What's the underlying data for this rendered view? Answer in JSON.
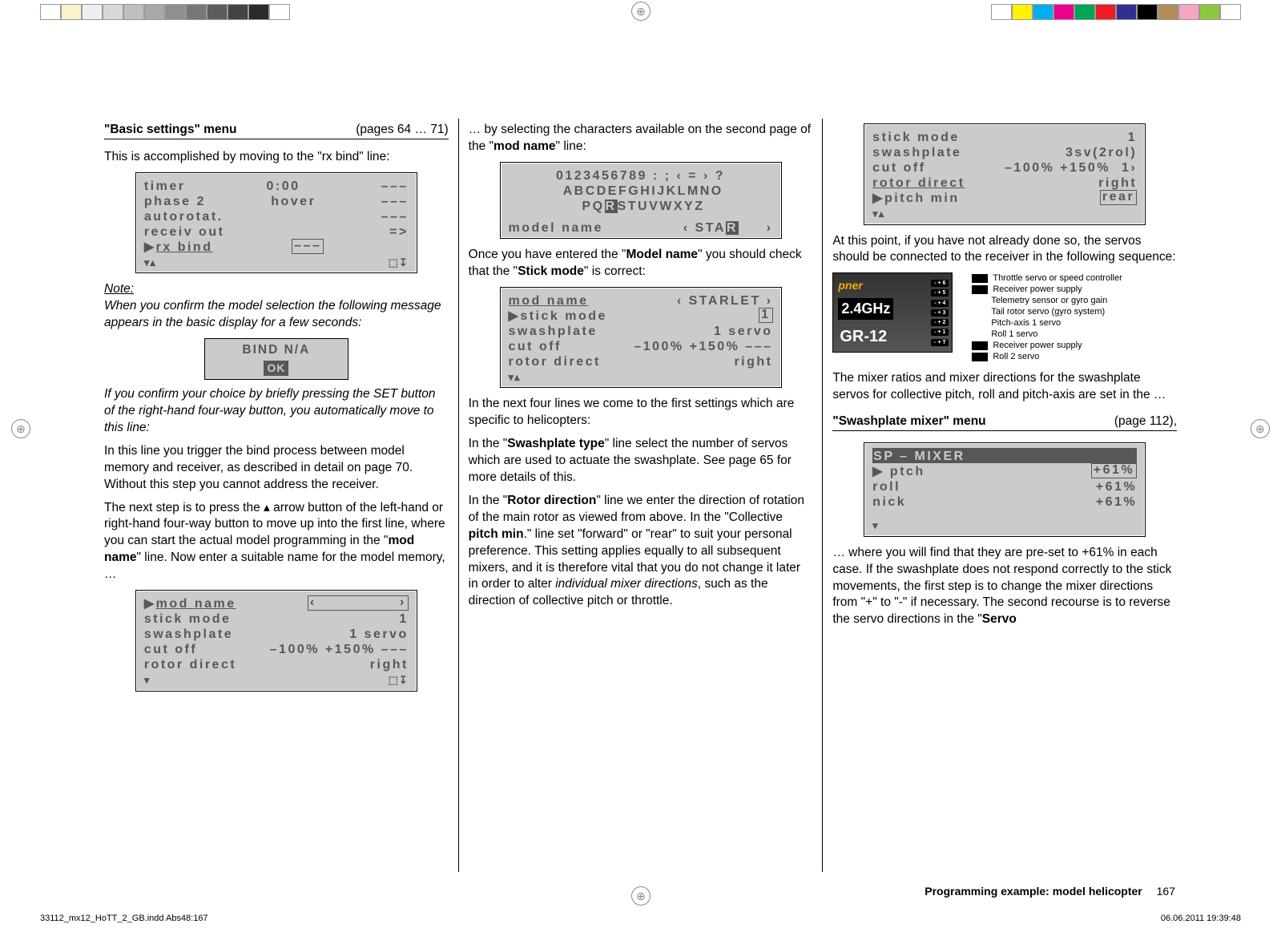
{
  "colorbars": {
    "left": [
      "#fff",
      "#f8f3c8",
      "#efefef",
      "#d8d8d8",
      "#bfbfbf",
      "#a8a8a8",
      "#8f8f8f",
      "#777",
      "#5d5d5d",
      "#444",
      "#2a2a2a",
      "#fff"
    ],
    "right": [
      "#fff",
      "#fff100",
      "#00aeef",
      "#ec008c",
      "#00a651",
      "#ed1c24",
      "#2e3192",
      "#000",
      "#b38b5d",
      "#f2a6c0",
      "#8dc63f",
      "#fff"
    ]
  },
  "col1": {
    "menu_label": "\"Basic settings\" menu",
    "pages_ref": "(pages 64 … 71)",
    "intro": "This is accomplished by moving to the \"rx bind\" line:",
    "lcd1": {
      "r1a": "timer",
      "r1b": "0:00",
      "r1c": "–––",
      "r2a": "phase 2",
      "r2b": "hover",
      "r2c": "–––",
      "r3a": "autorotat.",
      "r3b": "",
      "r3c": "–––",
      "r4a": "receiv out",
      "r4b": "",
      "r4c": "=>",
      "r5a": "rx bind",
      "r5b": "–––",
      "r5c": ""
    },
    "note_label": "Note:",
    "note_body": "When you confirm the model selection the following message appears in the basic display for a few seconds:",
    "bind_lcd": {
      "line1": "BIND N/A",
      "ok": "OK"
    },
    "after_ok": "If you confirm your choice by briefly pressing the SET button of the right-hand four-way button, you automatically move to this line:",
    "p3": "In this line you trigger the bind process between model memory and receiver, as described in detail on page 70. Without this step you cannot address the receiver.",
    "p4a": "The next step is to press the ",
    "p4b": " arrow button of the left-hand or right-hand four-way button to move up into the first line, where you can start the actual model programming in the \"",
    "p4c": "mod name",
    "p4d": "\" line. Now enter a suitable name for the model memory, …",
    "lcd2": {
      "r1a": "mod name",
      "r1b": "‹",
      "r1c": "›",
      "r2a": "stick mode",
      "r2b": "1",
      "r3a": "swashplate",
      "r3b": "1 servo",
      "r4a": "cut off",
      "r4b": "–100% +150% –––",
      "r5a": "rotor direct",
      "r5b": "right"
    }
  },
  "col2": {
    "p1a": "… by selecting the characters available on the second page of the \"",
    "p1b": "mod name",
    "p1c": "\" line:",
    "lcd_chars": {
      "l1": "0123456789 : ; ‹ = › ?",
      "l2": " ABCDEFGHIJKLMNO",
      "l3a": " PQ",
      "l3b": "R",
      "l3c": "STUVWXYZ",
      "ml_label": "model name",
      "ml_val": "‹ STA",
      "ml_inv": "R",
      "ml_close": "›"
    },
    "p2a": "Once you have entered the \"",
    "p2b": "Model name",
    "p2c": "\" you should check that the \"",
    "p2d": "Stick mode",
    "p2e": "\" is correct:",
    "lcd3": {
      "r1a": "mod name",
      "r1b": "‹ STARLET ›",
      "r2a": "stick mode",
      "r2b": "1",
      "r3a": "swashplate",
      "r3b": "1 servo",
      "r4a": "cut off",
      "r4b": "–100% +150% –––",
      "r5a": "rotor direct",
      "r5b": "right"
    },
    "p3": "In the next four lines we come to the first settings which are specific to helicopters:",
    "p4a": "In the \"",
    "p4b": "Swashplate type",
    "p4c": "\" line select the number of servos which are used to actuate the swashplate. See page 65 for more details of this.",
    "p5a": "In the \"",
    "p5b": "Rotor direction",
    "p5c": "\" line we enter the direction of rotation of the main rotor as viewed from above. In the \"Collective ",
    "p5d": "pitch min",
    "p5e": ".\" line set \"forward\" or \"rear\" to suit your personal preference. This setting applies equally to all subsequent mixers, and it is therefore vital that you do not change it later in order to alter ",
    "p5f": "individual mixer directions",
    "p5g": ", such as the direction of collective pitch or throttle."
  },
  "col3": {
    "lcd4": {
      "r1a": "stick mode",
      "r1b": "1",
      "r2a": "swashplate",
      "r2b": "3sv(2rol)",
      "r3a": "cut off",
      "r3b": "–100% +150%  1›",
      "r4a": "rotor direct",
      "r4b": "right",
      "r5a": "pitch min",
      "r5b": "rear"
    },
    "p1": "At this point, if you have not already done so, the servos should be connected to the receiver in the following sequence:",
    "rx": {
      "brand": "pner",
      "ghz": "2.4GHz",
      "model": "GR-12",
      "pins": [
        "- + 6",
        "- + 5",
        "- + 4",
        "- + 3",
        "- + 2",
        "- + 1",
        "- + T"
      ],
      "labels": [
        {
          "plug": true,
          "text": "Throttle servo or speed controller"
        },
        {
          "plug": true,
          "text": "Receiver power supply"
        },
        {
          "plug": false,
          "text": "Telemetry sensor or gyro gain"
        },
        {
          "plug": false,
          "text": "Tail rotor servo (gyro system)"
        },
        {
          "plug": false,
          "text": "Pitch-axis 1 servo"
        },
        {
          "plug": false,
          "text": "Roll 1 servo"
        },
        {
          "plug": true,
          "text": "Receiver power supply"
        },
        {
          "plug": true,
          "text": "Roll 2 servo"
        }
      ]
    },
    "p2": "The mixer ratios and mixer directions for the swashplate servos for collective pitch, roll and pitch-axis are set in the …",
    "menu2_label": "\"Swashplate mixer\" menu",
    "menu2_ref": "(page 112),",
    "lcd5": {
      "title": "SP – MIXER",
      "r1a": "ptch",
      "r1b": "+61%",
      "r2a": "roll",
      "r2b": "+61%",
      "r3a": "nick",
      "r3b": "+61%"
    },
    "p3a": "… where you will find that they are pre-set to +61% in each case. If the swashplate does not respond correctly to the stick movements, the first step is to change the mixer directions from \"+\" to \"-\" if necessary. The second recourse is to reverse the servo directions in the \"",
    "p3b": "Servo"
  },
  "footer": {
    "title": "Programming example: model helicopter",
    "page_num": "167",
    "imprint_left": "33112_mx12_HoTT_2_GB.indd   Abs48:167",
    "imprint_right": "06.06.2011   19:39:48"
  }
}
